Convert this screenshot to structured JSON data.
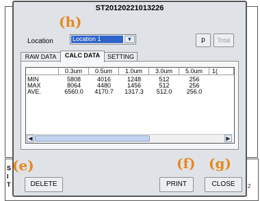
{
  "title": "ST20120221013226",
  "location": {
    "label": "Location",
    "value": "Location 1"
  },
  "buttons": {
    "p": "p",
    "total": "Total",
    "delete": "DELETE",
    "print": "PRINT",
    "close": "CLOSE"
  },
  "tabs": [
    "RAW DATA",
    "CALC DATA",
    "SETTING"
  ],
  "active_tab": "CALC DATA",
  "table": {
    "headers": [
      "",
      "0.3um",
      "0.5um",
      "1.0um",
      "3.0um",
      "5.0um",
      "1("
    ],
    "rows": [
      [
        "MIN",
        "5808",
        "4016",
        "1248",
        "512",
        "256",
        ""
      ],
      [
        "MAX",
        "8064",
        "4480",
        "1456",
        "512",
        "256",
        ""
      ],
      [
        "AVE.",
        "6560.0",
        "4170.7",
        "1317.3",
        "512.0",
        "256.0",
        ""
      ]
    ]
  },
  "markers": {
    "h": "(h)",
    "e": "(e)",
    "f": "(f)",
    "g": "(g)"
  },
  "background_fragments": {
    "left_letters": [
      "S",
      "I",
      "T"
    ],
    "right_digit": "2"
  },
  "colors": {
    "marker": "#e8871e",
    "selection": "#2f63c8",
    "dialog_bg": "#dfe3e7"
  }
}
